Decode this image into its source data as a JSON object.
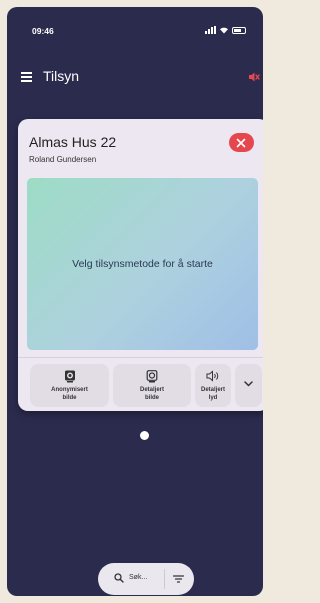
{
  "status_bar": {
    "time": "09:46"
  },
  "app_bar": {
    "title": "Tilsyn"
  },
  "card": {
    "title": "Almas Hus 22",
    "subtitle": "Roland Gundersen",
    "preview_text": "Velg tilsynsmetode for å starte",
    "methods": [
      {
        "icon": "anonymized-camera-icon",
        "line1": "Anonymisert",
        "line2": "bilde"
      },
      {
        "icon": "detailed-camera-icon",
        "line1": "Detaljert",
        "line2": "bilde"
      },
      {
        "icon": "speaker-sound-icon",
        "line1": "Detaljert",
        "line2": "lyd"
      }
    ]
  },
  "search": {
    "label": "Søk..."
  },
  "colors": {
    "background": "#2b2b4e",
    "accent_close": "#e5474e",
    "mute_icon": "#e5474e"
  }
}
